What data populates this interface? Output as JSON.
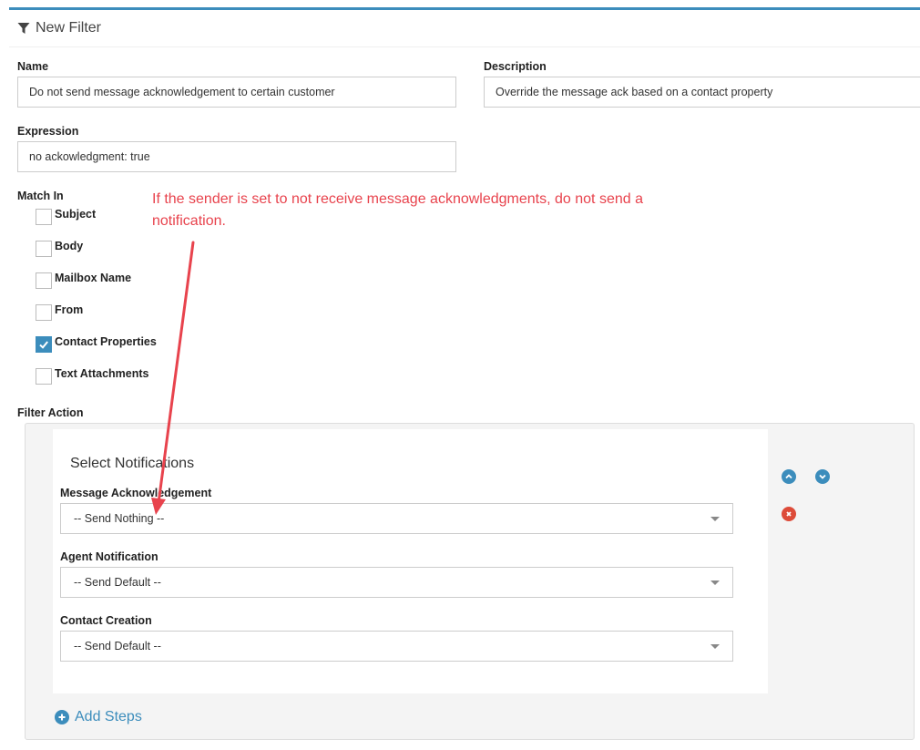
{
  "header": {
    "title": "New Filter",
    "icon": "filter-icon"
  },
  "form": {
    "name": {
      "label": "Name",
      "value": "Do not send message acknowledgement to certain customer"
    },
    "description": {
      "label": "Description",
      "value": "Override the message ack based on a contact property"
    },
    "expression": {
      "label": "Expression",
      "value": "no ackowledgment: true"
    },
    "match_in": {
      "label": "Match In",
      "options": [
        {
          "label": "Subject",
          "checked": false
        },
        {
          "label": "Body",
          "checked": false
        },
        {
          "label": "Mailbox Name",
          "checked": false
        },
        {
          "label": "From",
          "checked": false
        },
        {
          "label": "Contact Properties",
          "checked": true
        },
        {
          "label": "Text Attachments",
          "checked": false
        }
      ]
    },
    "filter_action": {
      "label": "Filter Action"
    }
  },
  "annotation": {
    "text": "If the sender is set to not receive message acknowledgments, do not send a notification.",
    "color": "#e8434d"
  },
  "action_panel": {
    "title": "Select Notifications",
    "message_ack": {
      "label": "Message Acknowledgement",
      "selected": "-- Send Nothing --"
    },
    "agent_notification": {
      "label": "Agent Notification",
      "selected": "-- Send Default --"
    },
    "contact_creation": {
      "label": "Contact Creation",
      "selected": "-- Send Default --"
    }
  },
  "add_steps": {
    "label": "Add Steps"
  },
  "colors": {
    "accent": "#3c8dbc",
    "danger": "#dd4b39"
  }
}
